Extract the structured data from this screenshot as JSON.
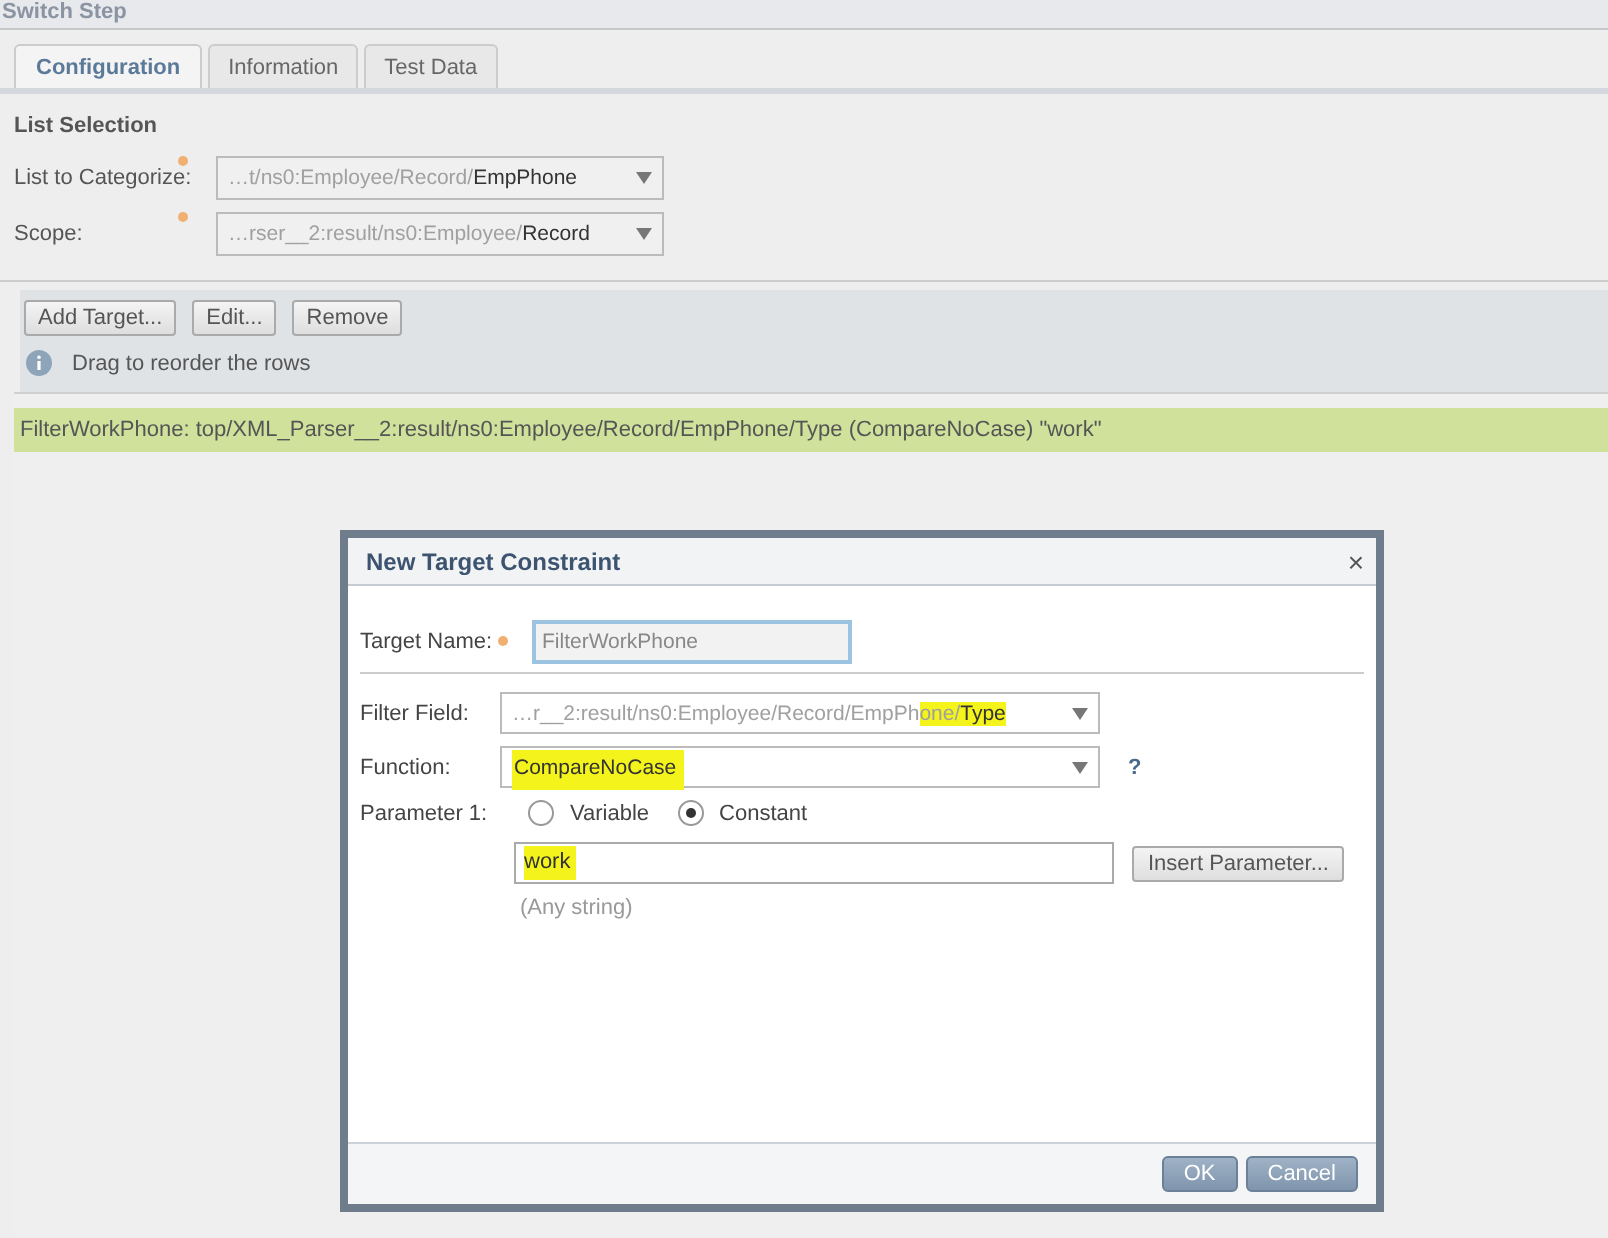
{
  "window": {
    "title": "Switch Step"
  },
  "tabs": [
    {
      "label": "Configuration",
      "selected": true
    },
    {
      "label": "Information",
      "selected": false
    },
    {
      "label": "Test Data",
      "selected": false
    }
  ],
  "list_selection": {
    "heading": "List Selection",
    "fields": [
      {
        "label": "List to Categorize:",
        "required": true,
        "segments": [
          {
            "text": "…t/ns0:Employee/Record/",
            "dim": true
          },
          {
            "text": "EmpPhone",
            "dim": false
          }
        ]
      },
      {
        "label": "Scope:",
        "required": true,
        "segments": [
          {
            "text": "…rser__2:result/ns0:Employee/",
            "dim": true
          },
          {
            "text": "Record",
            "dim": false
          }
        ]
      }
    ]
  },
  "toolbar": {
    "buttons": [
      "Add Target...",
      "Edit...",
      "Remove"
    ],
    "hint": "Drag to reorder the rows"
  },
  "targets": [
    {
      "text": "FilterWorkPhone: top/XML_Parser__2:result/ns0:Employee/Record/EmpPhone/Type (CompareNoCase) \"work\"",
      "selected": true
    }
  ],
  "dialog": {
    "title": "New Target Constraint",
    "close": "×",
    "target_name": {
      "label": "Target Name:",
      "required": true,
      "value": "FilterWorkPhone"
    },
    "filter_field": {
      "label": "Filter Field:",
      "segments": [
        {
          "text": "…r__2:result/ns0:Employee/Record/EmpPh",
          "dim": true,
          "highlighted": false
        },
        {
          "text": "one/",
          "dim": true,
          "highlighted": true
        },
        {
          "text": "Type",
          "dim": false,
          "highlighted": true
        }
      ]
    },
    "function": {
      "label": "Function:",
      "value": "CompareNoCase",
      "highlighted": true,
      "help": "?"
    },
    "parameter": {
      "label": "Parameter 1:",
      "options": [
        {
          "label": "Variable",
          "selected": false
        },
        {
          "label": "Constant",
          "selected": true
        }
      ],
      "value": "work",
      "highlighted": true,
      "insert_button": "Insert Parameter...",
      "hint": "(Any string)"
    },
    "buttons": [
      "OK",
      "Cancel"
    ]
  }
}
